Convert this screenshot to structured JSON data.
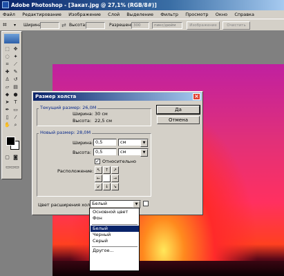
{
  "window": {
    "title": "Adobe Photoshop - [Закат.jpg @ 27,1% (RGB/8#)]"
  },
  "menu": [
    "Файл",
    "Редактирование",
    "Изображение",
    "Слой",
    "Выделение",
    "Фильтр",
    "Просмотр",
    "Окно",
    "Справка"
  ],
  "options_bar": {
    "width_label": "Ширина:",
    "height_label": "Высота:",
    "resolution_label": "Разрешение:",
    "resolution_value": "300",
    "resolution_unit": "пикс/дюйм",
    "image_button": "Изображение",
    "clear_button": "Очистить"
  },
  "dialog": {
    "title": "Размер холста",
    "current_size": {
      "label": "Текущий размер: 26,0M",
      "width_label": "Ширина:",
      "width_value": "30 см",
      "height_label": "Высота:",
      "height_value": "22,5 см"
    },
    "new_size": {
      "label": "Новый размер: 28,0M",
      "width_label": "Ширина:",
      "width_value": "0,5",
      "width_unit": "см",
      "height_label": "Высота:",
      "height_value": "0,5",
      "height_unit": "см",
      "relative_label": "Относительно",
      "relative_checked": true,
      "anchor_label": "Расположение:"
    },
    "ok_button": "Да",
    "cancel_button": "Отмена",
    "extension_color_label": "Цвет расширения холста:",
    "extension_color_value": "Белый"
  },
  "color_dropdown": {
    "options": [
      "Основной цвет",
      "Фон",
      "Белый",
      "Черный",
      "Серый",
      "Другое..."
    ],
    "selected": "Белый"
  }
}
